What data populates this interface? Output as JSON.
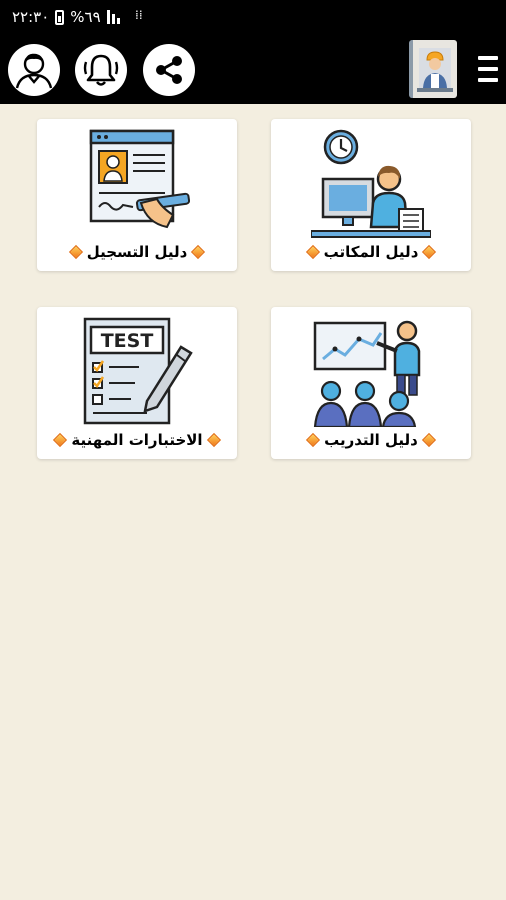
{
  "status_bar": {
    "time": "٢٢:٣٠",
    "battery": "%٦٩"
  },
  "toolbar": {
    "profile_icon": "user-avatar-icon",
    "notification_icon": "bell-icon",
    "share_icon": "share-icon",
    "logo_icon": "engineer-logo-icon",
    "menu_icon": "hamburger-menu-icon"
  },
  "cards": [
    {
      "id": "offices",
      "label": "دليل المكاتب",
      "icon": "office-worker-icon"
    },
    {
      "id": "registration",
      "label": "دليل التسجيل",
      "icon": "registration-form-icon"
    },
    {
      "id": "training",
      "label": "دليل التدريب",
      "icon": "training-presentation-icon"
    },
    {
      "id": "tests",
      "label": "الاختبارات المهنية",
      "icon": "test-paper-icon"
    }
  ],
  "test_sheet_text": "TEST",
  "colors": {
    "bar": "#000000",
    "background": "#f3eee0",
    "card": "#ffffff",
    "diamond": "#f07a1a"
  }
}
